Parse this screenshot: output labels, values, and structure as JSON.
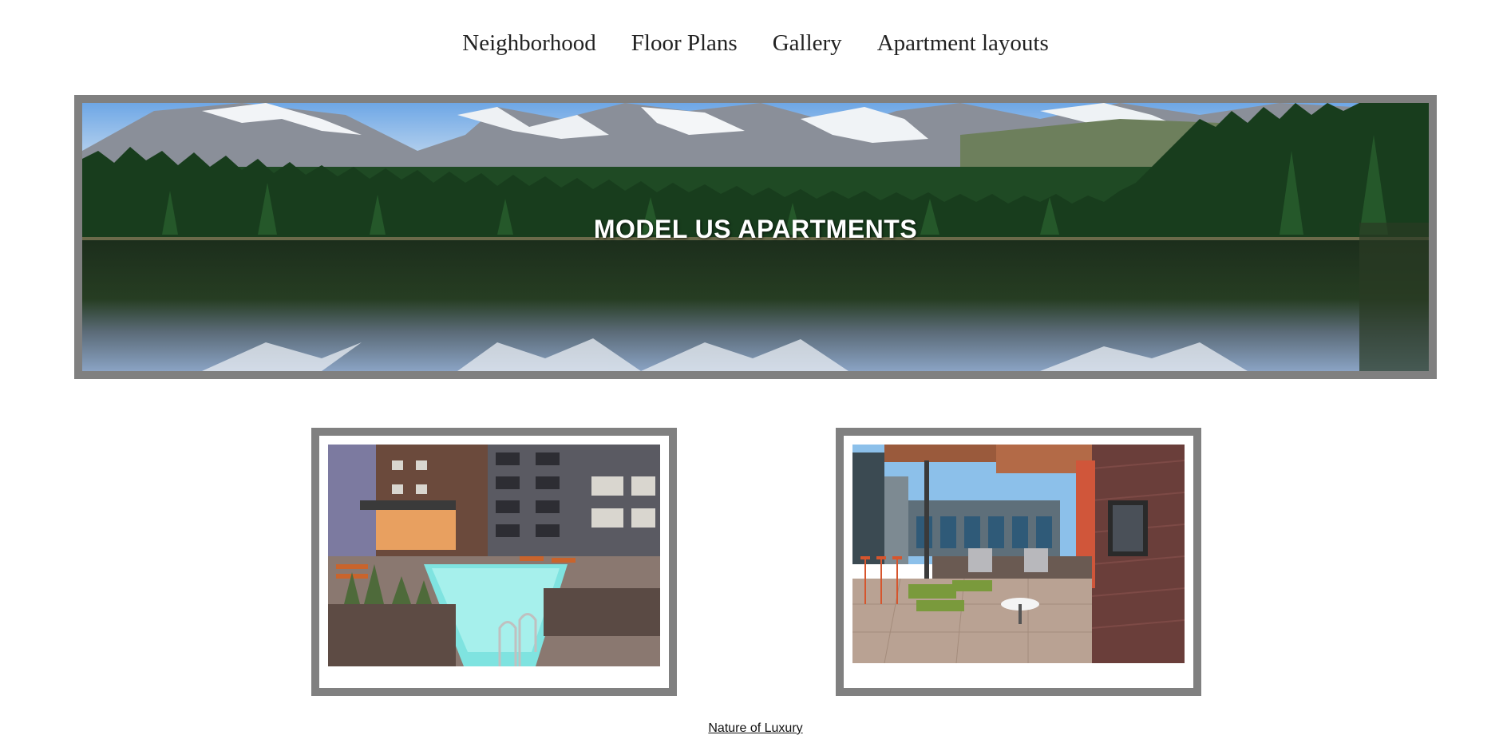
{
  "nav": {
    "items": [
      {
        "label": "Neighborhood"
      },
      {
        "label": "Floor Plans"
      },
      {
        "label": "Gallery"
      },
      {
        "label": "Apartment layouts"
      }
    ]
  },
  "hero": {
    "title": "MODEL US APARTMENTS",
    "image": "mountain-lake-forest-reflection"
  },
  "gallery": {
    "cards": [
      {
        "image": "apartment-courtyard-pool"
      },
      {
        "image": "rooftop-patio-stadium-view"
      }
    ]
  },
  "footer": {
    "link_label": "Nature of Luxury"
  },
  "colors": {
    "frame": "#808080",
    "background": "#ffffff",
    "hero_text": "#ffffff"
  }
}
